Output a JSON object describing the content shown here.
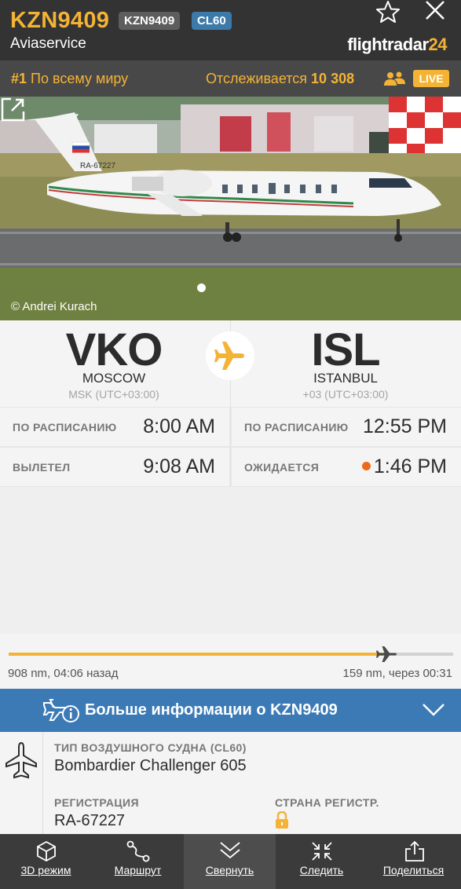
{
  "header": {
    "flight_id": "KZN9409",
    "callsign_chip": "KZN9409",
    "type_chip": "CL60",
    "airline": "Aviaservice",
    "logo_text": "flightradar",
    "logo_num": "24"
  },
  "rank_bar": {
    "rank_num": "#1",
    "rank_text": "По всему миру",
    "tracked_label": "Отслеживается",
    "tracked_count": "10 308",
    "live": "LIVE"
  },
  "photo": {
    "credit": "© Andrei Kurach",
    "registration_on_tail": "RA-67227"
  },
  "route": {
    "departure": {
      "iata": "VKO",
      "city": "MOSCOW",
      "tz": "MSK (UTC+03:00)"
    },
    "arrival": {
      "iata": "ISL",
      "city": "ISTANBUL",
      "tz": "+03 (UTC+03:00)"
    }
  },
  "times": {
    "dep_scheduled_label": "ПО РАСПИСАНИЮ",
    "dep_scheduled": "8:00 AM",
    "dep_actual_label": "ВЫЛЕТЕЛ",
    "dep_actual": "9:08 AM",
    "arr_scheduled_label": "ПО РАСПИСАНИЮ",
    "arr_scheduled": "12:55 PM",
    "arr_expected_label": "ОЖИДАЕТСЯ",
    "arr_expected": "1:46 PM"
  },
  "progress": {
    "fraction": 0.85,
    "elapsed": "908 nm, 04:06 назад",
    "remaining": "159 nm, через 00:31"
  },
  "more_info": {
    "text": "Больше информации о KZN9409"
  },
  "details": {
    "aircraft_type_label": "ТИП ВОЗДУШНОГО СУДНА (CL60)",
    "aircraft_type": "Bombardier Challenger 605",
    "registration_label": "РЕГИСТРАЦИЯ",
    "registration": "RA-67227",
    "country_label": "СТРАНА РЕГИСТР."
  },
  "tabbar": {
    "tabs": [
      {
        "label": "3D режим",
        "icon": "cube-icon"
      },
      {
        "label": "Маршрут",
        "icon": "route-icon"
      },
      {
        "label": "Свернуть",
        "icon": "collapse-icon"
      },
      {
        "label": "Следить",
        "icon": "follow-icon"
      },
      {
        "label": "Поделиться",
        "icon": "share-icon"
      }
    ]
  },
  "colors": {
    "accent": "#f5b335",
    "header_bg": "#333333",
    "info_blue": "#3c7ab6",
    "expected_dot": "#ee6a1b"
  }
}
